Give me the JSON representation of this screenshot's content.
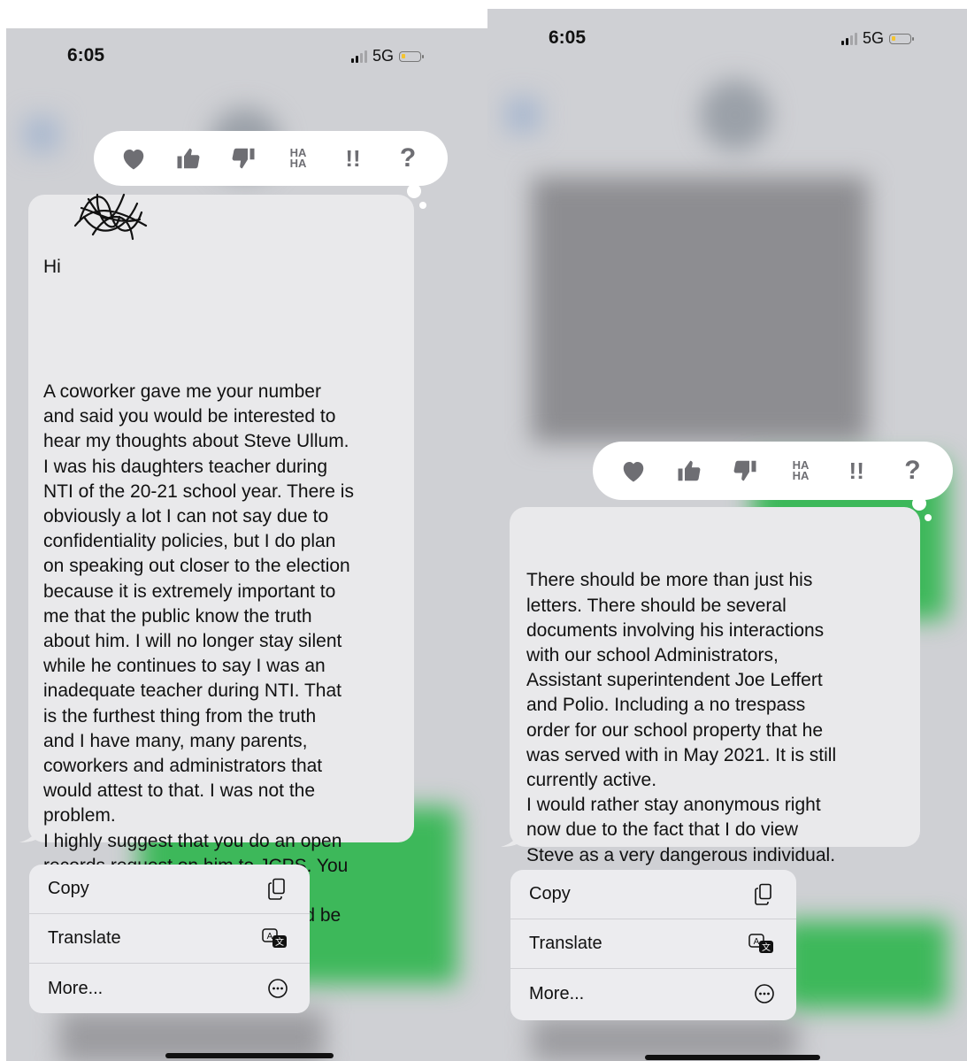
{
  "left": {
    "status": {
      "time": "6:05",
      "network": "5G"
    },
    "reactions": [
      "heart",
      "thumbs-up",
      "thumbs-down",
      "HA HA",
      "!!",
      "?"
    ],
    "message": {
      "greeting": "Hi",
      "body": "A coworker gave me your number\nand said you would be interested to\nhear my thoughts about Steve Ullum.\nI was his daughters teacher during\nNTI of the 20-21 school year. There is\nobviously a lot I can not say due to\nconfidentiality policies, but I do plan\non speaking out closer to the election\nbecause it is extremely important to\nme that the public know the truth\nabout him. I will no longer stay silent\nwhile he continues to say I was an\ninadequate teacher during NTI. That\nis the furthest thing from the truth\nand I have many, many parents,\ncoworkers and administrators that\nwould attest to that. I was not the\nproblem.\nI highly suggest that you do an open\nrecords request on him to JCPS. You\nwill be able to uncover several\ndocuments that the public should be\naware of."
    },
    "menu": {
      "copy": "Copy",
      "translate": "Translate",
      "more": "More..."
    }
  },
  "right": {
    "status": {
      "time": "6:05",
      "network": "5G"
    },
    "reactions": [
      "heart",
      "thumbs-up",
      "thumbs-down",
      "HA HA",
      "!!",
      "?"
    ],
    "message": {
      "body": "There should be more than just his\nletters. There should be several\ndocuments involving his interactions\nwith our school Administrators,\nAssistant superintendent Joe Leffert\nand Polio. Including a no trespass\norder for our school property that he\nwas served with in May 2021. It is still\ncurrently active.\nI would rather stay anonymous right\nnow due to the fact that I do view\nSteve as a very dangerous individual."
    },
    "menu": {
      "copy": "Copy",
      "translate": "Translate",
      "more": "More..."
    }
  },
  "reaction_labels": {
    "haha": "HA\nHA",
    "exclaim": "!!",
    "question": "?"
  },
  "colors": {
    "bubble": "#e9e9eb",
    "sent_bubble": "#34c759",
    "icon": "#6e6e73"
  }
}
